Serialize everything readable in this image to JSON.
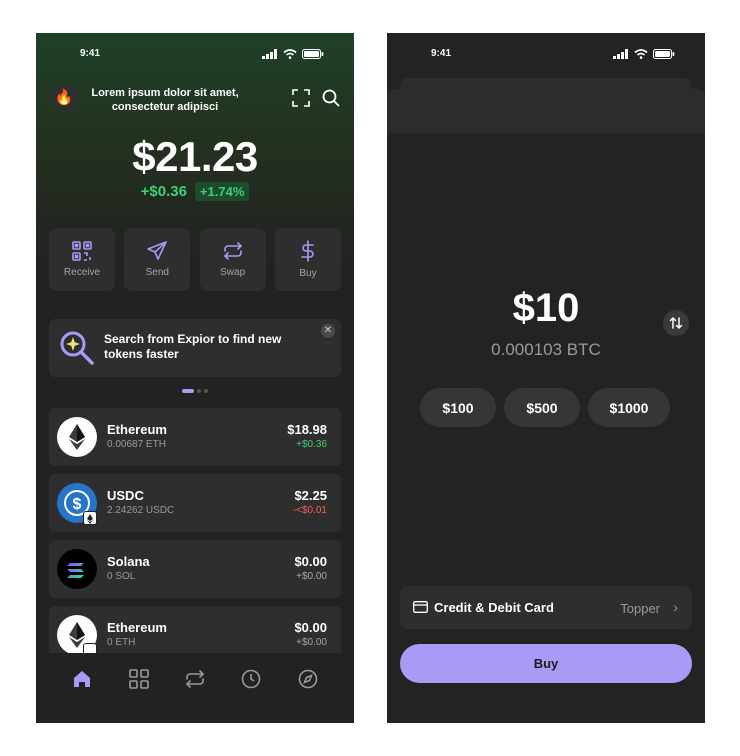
{
  "screen_wallet": {
    "status_time": "9:41",
    "account_title": "Lorem ipsum dolor sit amet, consectetur adipisci",
    "balance": "$21.23",
    "change_abs": "+$0.36",
    "change_pct": "+1.74%",
    "actions": [
      {
        "label": "Receive",
        "icon": "qr-code-icon"
      },
      {
        "label": "Send",
        "icon": "send-icon"
      },
      {
        "label": "Swap",
        "icon": "swap-icon"
      },
      {
        "label": "Buy",
        "icon": "dollar-icon"
      }
    ],
    "promo": {
      "text": "Search from Expior to find new tokens faster",
      "close": "✕"
    },
    "tokens": [
      {
        "name": "Ethereum",
        "amount": "0.00687 ETH",
        "value": "$18.98",
        "change": "+$0.36",
        "trend": "up"
      },
      {
        "name": "USDC",
        "amount": "2.24262 USDC",
        "value": "$2.25",
        "change": "-<$0.01",
        "trend": "down"
      },
      {
        "name": "Solana",
        "amount": "0 SOL",
        "value": "$0.00",
        "change": "+$0.00",
        "trend": "flat"
      },
      {
        "name": "Ethereum",
        "amount": "0 ETH",
        "value": "$0.00",
        "change": "+$0.00",
        "trend": "flat"
      }
    ],
    "nav": [
      "home-icon",
      "grid-icon",
      "swap-arrows-icon",
      "history-clock-icon",
      "explore-compass-icon"
    ],
    "colors": {
      "accent": "#a99af5",
      "positive": "#3ed071",
      "negative": "#ff5a5a"
    }
  },
  "screen_buy": {
    "status_time": "9:41",
    "amount": "$10",
    "amount_crypto": "0.000103 BTC",
    "presets": [
      "$100",
      "$500",
      "$1000"
    ],
    "payment_method": "Credit & Debit Card",
    "provider": "Topper",
    "buy_label": "Buy"
  }
}
